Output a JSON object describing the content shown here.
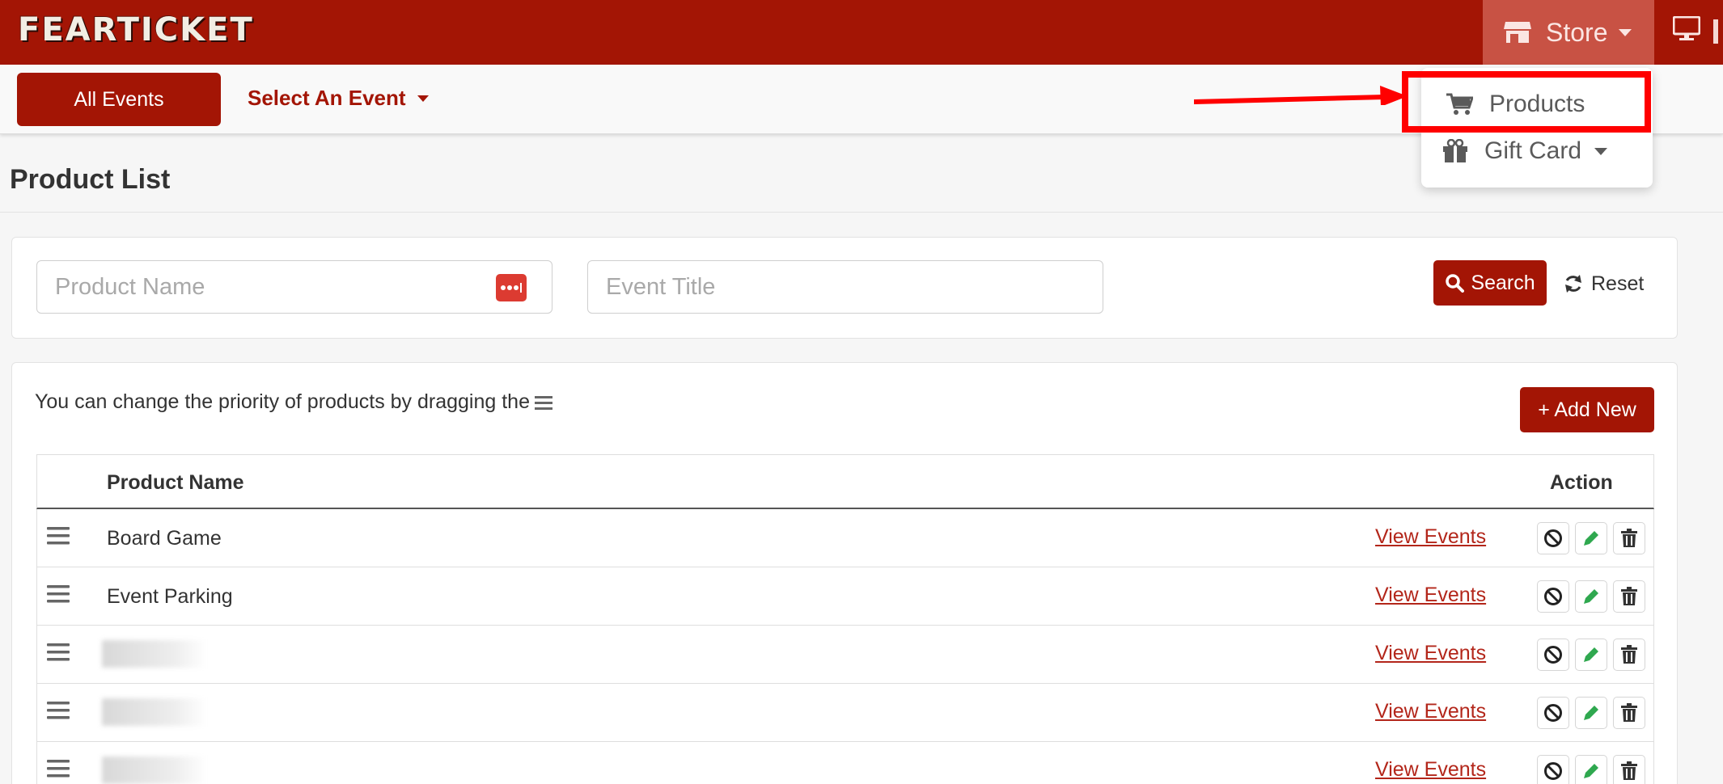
{
  "header": {
    "logo_text": "FEARTICKET",
    "store_label": "Store"
  },
  "subnav": {
    "all_events_label": "All Events",
    "select_event_label": "Select An Event"
  },
  "store_menu": {
    "products_label": "Products",
    "gift_card_label": "Gift Card"
  },
  "page": {
    "title": "Product List"
  },
  "search": {
    "product_name_placeholder": "Product Name",
    "event_title_placeholder": "Event Title",
    "search_label": "Search",
    "reset_label": "Reset"
  },
  "list": {
    "hint_text": "You can change the priority of products by dragging the",
    "add_new_label": "+ Add New",
    "columns": {
      "product_name": "Product Name",
      "action": "Action"
    },
    "rows": [
      {
        "name": "Board Game",
        "link": "View Events"
      },
      {
        "name": "Event Parking",
        "link": "View Events"
      },
      {
        "name": "",
        "link": "View Events"
      },
      {
        "name": "",
        "link": "View Events"
      },
      {
        "name": "",
        "link": "View Events"
      }
    ]
  },
  "colors": {
    "brand_red": "#a31505",
    "edit_green": "#2fa84f",
    "annotation_red": "#ff0000"
  },
  "icons": [
    "store-icon",
    "monitor-icon",
    "cart-icon",
    "gift-icon",
    "password-manager-icon",
    "search-icon",
    "refresh-icon",
    "drag-handle-icon",
    "ban-icon",
    "pencil-icon",
    "trash-icon"
  ]
}
